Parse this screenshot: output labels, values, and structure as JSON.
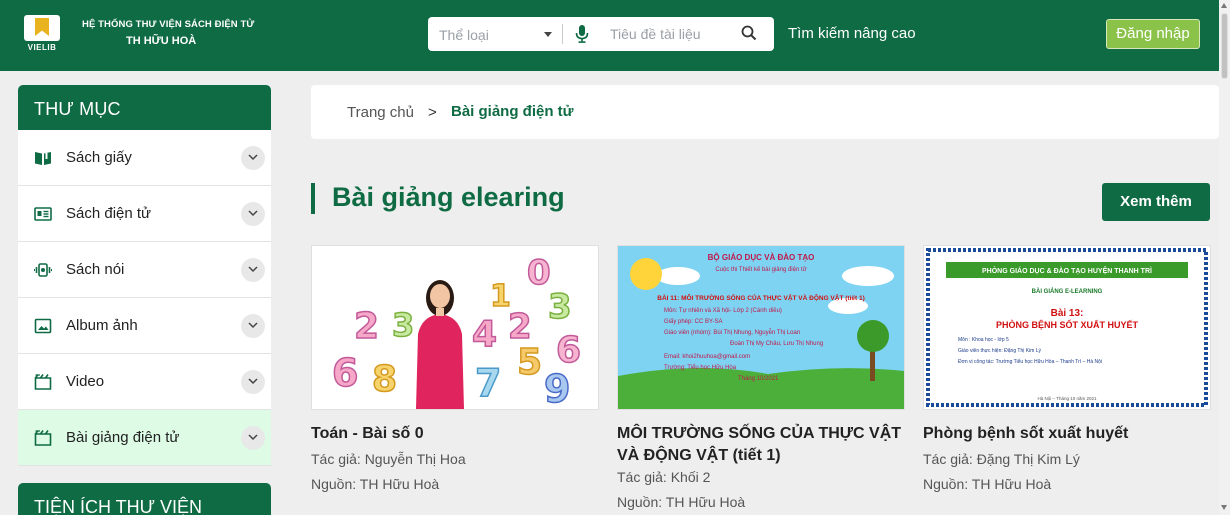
{
  "header": {
    "logo_text": "VIELIB",
    "brand_line1": "HỆ THỐNG THƯ VIỆN SÁCH ĐIỆN TỬ",
    "brand_line2": "TH HỮU HOÀ",
    "genre_placeholder": "Thể loại",
    "title_placeholder": "Tiêu đề tài liệu",
    "advanced_search": "Tìm kiếm nâng cao",
    "login": "Đăng nhập"
  },
  "sidebar": {
    "heading": "THƯ MỤC",
    "items": [
      {
        "label": "Sách giấy",
        "icon": "book-open-icon"
      },
      {
        "label": "Sách điện tử",
        "icon": "ebook-icon"
      },
      {
        "label": "Sách nói",
        "icon": "audio-icon"
      },
      {
        "label": "Album ảnh",
        "icon": "image-icon"
      },
      {
        "label": "Video",
        "icon": "video-icon"
      },
      {
        "label": "Bài giảng điện tử",
        "icon": "lecture-icon",
        "active": true
      }
    ],
    "heading2": "TIỆN ÍCH THƯ VIỆN"
  },
  "breadcrumb": {
    "home": "Trang chủ",
    "separator": ">",
    "current": "Bài giảng điện tử"
  },
  "section": {
    "title": "Bài giảng elearing",
    "more": "Xem thêm"
  },
  "cards": [
    {
      "title": "Toán - Bài số 0",
      "author": "Tác giả: Nguyễn Thị Hoa",
      "source": "Nguồn: TH Hữu Hoà",
      "thumb_digits": [
        "0",
        "1",
        "2",
        "3",
        "4",
        "5",
        "6",
        "7",
        "8",
        "9",
        "2",
        "3",
        "6"
      ]
    },
    {
      "title": "MÔI TRƯỜNG SỐNG CỦA THỰC VẬT VÀ ĐỘNG VẬT (tiết 1)",
      "author": "Tác giả: Khối 2",
      "source": "Nguồn: TH Hữu Hoà",
      "thumb": {
        "line1": "BỘ GIÁO DỤC VÀ ĐÀO TẠO",
        "line2": "Cuộc thi Thiết kế bài giảng điện tử",
        "line3": "BÀI 11: MÔI TRƯỜNG SỐNG CỦA THỰC VẬT VÀ ĐỘNG VẬT (tiết 1)",
        "line4": "Môn: Tự nhiên và Xã hội- Lớp 2 (Cánh diều)",
        "line5": "Giấy phép: CC BY-SA",
        "line6": "Giáo viên (nhóm): Bùi Thị Nhung, Nguyễn Thị Loan",
        "line7": "Đoàn Thị My Châu, Lưu Thị Nhung",
        "line8": "Email: khoi2huuhoa@gmail.com",
        "line9": "Trường: Tiểu học Hữu Hòa",
        "line10": "Tháng 10/2021"
      }
    },
    {
      "title": "Phòng bệnh sốt xuất huyết",
      "author": "Tác giả: Đặng Thị Kim Lý",
      "source": "Nguồn: TH Hữu Hoà",
      "thumb": {
        "banner": "PHÒNG GIÁO DỤC & ĐÀO TẠO HUYỆN THANH TRÌ",
        "label": "BÀI GIẢNG E-LEARNING",
        "lesson": "Bài 13:",
        "lesson_title": "PHÒNG BỆNH SỐT XUẤT HUYẾT",
        "subject": "Môn : Khoa học - lớp 5",
        "teacher": "Giáo viên thực hiện: Đặng Thị Kim Lý",
        "school": "Đơn vị công tác: Trường Tiểu học Hữu Hòa – Thanh Trì – Hà Nội",
        "date": "Hà Nội – Tháng 10 năm 2021"
      }
    }
  ],
  "colors": {
    "primary": "#0f6b44",
    "login_button": "#8bc34a",
    "active_item_bg": "#ddfbe5",
    "page_bg": "#eeeeee"
  }
}
